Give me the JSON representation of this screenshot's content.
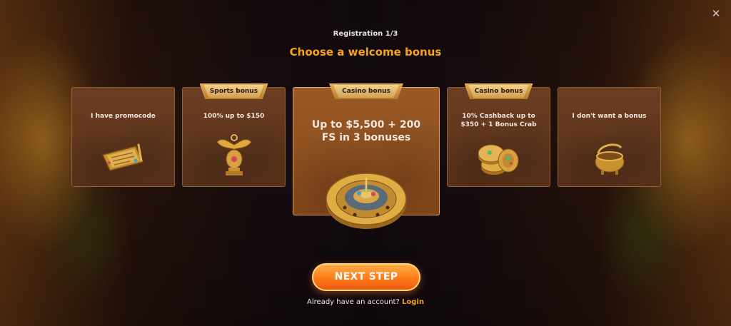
{
  "modal": {
    "step": "Registration 1/3",
    "title": "Choose a welcome bonus",
    "close_icon": "close-icon"
  },
  "bonuses": [
    {
      "ribbon": "",
      "text": "I have promocode",
      "icon": "promocode-ticket-icon"
    },
    {
      "ribbon": "Sports bonus",
      "text": "100% up to $150",
      "icon": "trophy-icon"
    },
    {
      "ribbon": "Casino bonus",
      "text": "Up to $5,500 + 200 FS in 3 bonuses",
      "icon": "roulette-icon",
      "selected": true
    },
    {
      "ribbon": "Casino bonus",
      "text": "10% Cashback up to $350 + 1 Bonus Crab",
      "icon": "coins-icon"
    },
    {
      "ribbon": "",
      "text": "I don't want a bonus",
      "icon": "empty-pot-icon"
    }
  ],
  "actions": {
    "next_label": "NEXT STEP",
    "account_prompt": "Already have an account?",
    "login_label": "Login"
  },
  "colors": {
    "accent": "#f7a21b",
    "button": "#ff7a1a",
    "card": "#6b3e22",
    "card_selected": "#9a5a26"
  }
}
